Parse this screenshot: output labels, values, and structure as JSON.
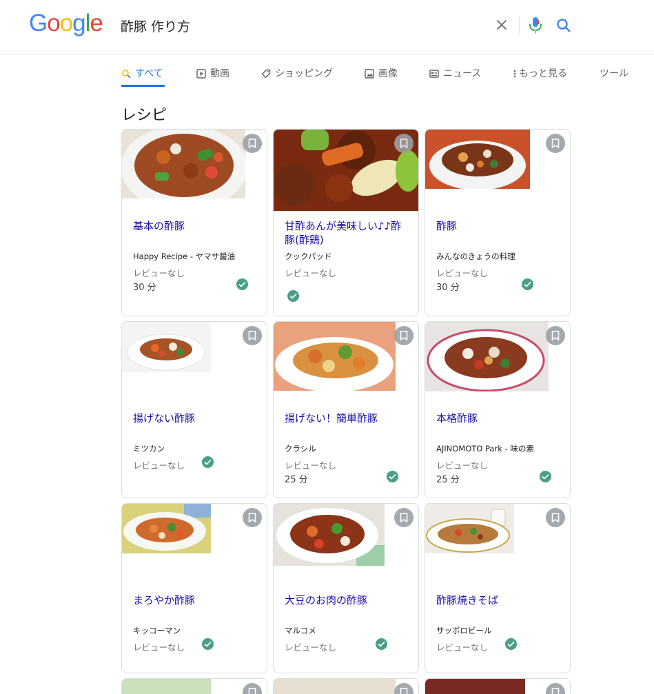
{
  "search": {
    "query": "酢豚 作り方"
  },
  "tabs": [
    {
      "label": "すべて",
      "icon": "search-icon"
    },
    {
      "label": "動画",
      "icon": "video-icon"
    },
    {
      "label": "ショッピング",
      "icon": "tag-icon"
    },
    {
      "label": "画像",
      "icon": "image-icon"
    },
    {
      "label": "ニュース",
      "icon": "news-icon"
    },
    {
      "label": "もっと見る",
      "icon": "more-vert-icon"
    },
    {
      "label": "ツール",
      "icon": ""
    }
  ],
  "section_title": "レシピ",
  "recipes": [
    {
      "title": "基本の酢豚",
      "source": "Happy Recipe - ヤマサ醤油",
      "review": "レビューなし",
      "time": "30 分"
    },
    {
      "title": "甘酢あんが美味しい♪♪酢豚(酢鶏)",
      "source": "クックパッド",
      "review": "レビューなし",
      "time": ""
    },
    {
      "title": "酢豚",
      "source": "みんなのきょうの料理",
      "review": "レビューなし",
      "time": "30 分"
    },
    {
      "title": "揚げない酢豚",
      "source": "ミツカン",
      "review": "レビューなし",
      "time": ""
    },
    {
      "title": "揚げない！簡単酢豚",
      "source": "クラシル",
      "review": "レビューなし",
      "time": "25 分"
    },
    {
      "title": "本格酢豚",
      "source": "AJINOMOTO Park - 味の素",
      "review": "レビューなし",
      "time": "25 分"
    },
    {
      "title": "まろやか酢豚",
      "source": "キッコーマン",
      "review": "レビューなし",
      "time": ""
    },
    {
      "title": "大豆のお肉の酢豚",
      "source": "マルコメ",
      "review": "レビューなし",
      "time": ""
    },
    {
      "title": "酢豚焼きそば",
      "source": "サッポロビール",
      "review": "レビューなし",
      "time": ""
    }
  ],
  "colors": {
    "link": "#1a0dab",
    "accent": "#1a73e8",
    "check": "#4a9e86"
  }
}
